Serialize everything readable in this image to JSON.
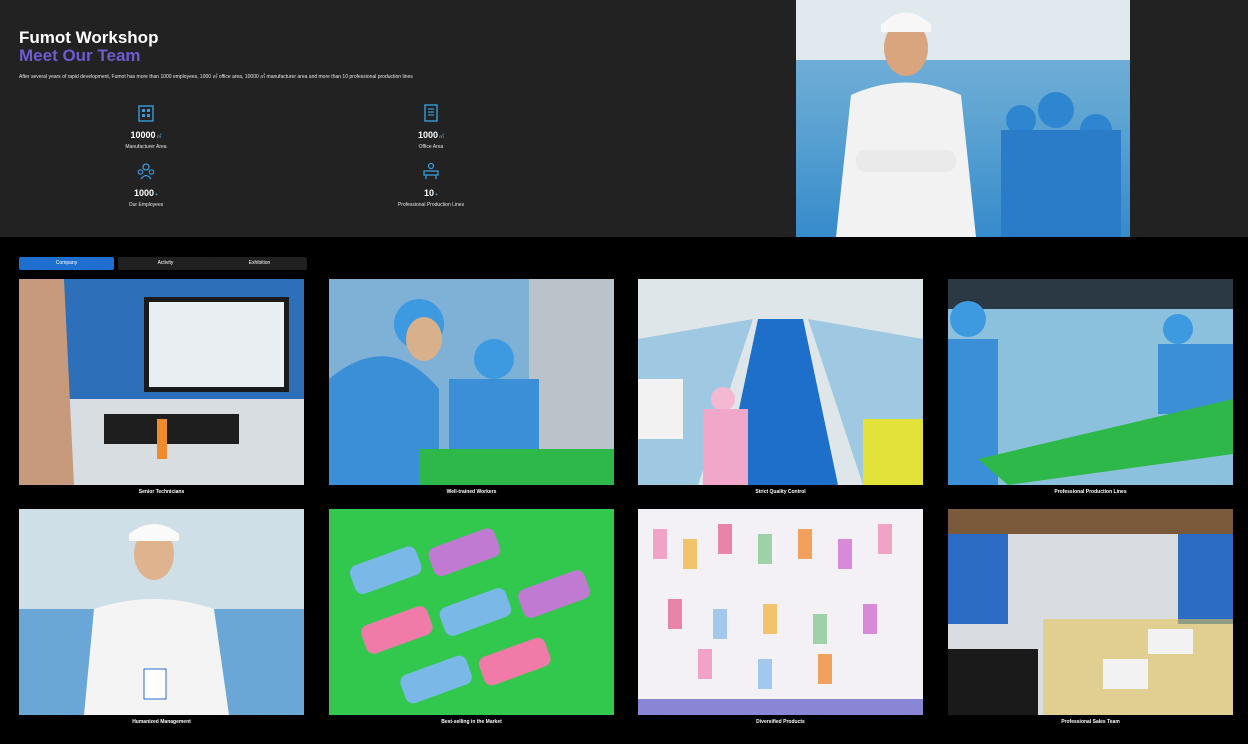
{
  "hero": {
    "title": "Fumot Workshop",
    "subtitle": "Meet Our Team",
    "description": "After several years of rapid development, Fumot has more than 1000 employees, 1000 ㎡ office area, 10000 ㎡ manufacturer area and more than 10 professional production lines",
    "stats": [
      {
        "value": "10000",
        "unit": "㎡",
        "label": "Manufacturer Area",
        "icon": "factory-icon"
      },
      {
        "value": "1000",
        "unit": "㎡",
        "label": "Office Area",
        "icon": "office-building-icon"
      },
      {
        "value": "1000",
        "unit": "+",
        "label": "Our Employees",
        "icon": "team-icon"
      },
      {
        "value": "10",
        "unit": "+",
        "label": "Professional Production Lines",
        "icon": "production-line-icon"
      }
    ]
  },
  "tabs": [
    {
      "label": "Company",
      "active": true
    },
    {
      "label": "Activity",
      "active": false
    },
    {
      "label": "Exhibition",
      "active": false
    }
  ],
  "gallery": [
    {
      "caption": "Senior Technicians"
    },
    {
      "caption": "Well-trained Workers"
    },
    {
      "caption": "Strict Quality Control"
    },
    {
      "caption": "Professional Production Lines"
    },
    {
      "caption": "Humanized Management"
    },
    {
      "caption": "Best-selling in the Market"
    },
    {
      "caption": "Diversified Products"
    },
    {
      "caption": "Professional Sales Team"
    }
  ],
  "colors": {
    "hero_bg": "#222223",
    "accent_purple": "#6c5bd1",
    "tab_active": "#1f6fd0",
    "tab_inactive": "#202020"
  }
}
